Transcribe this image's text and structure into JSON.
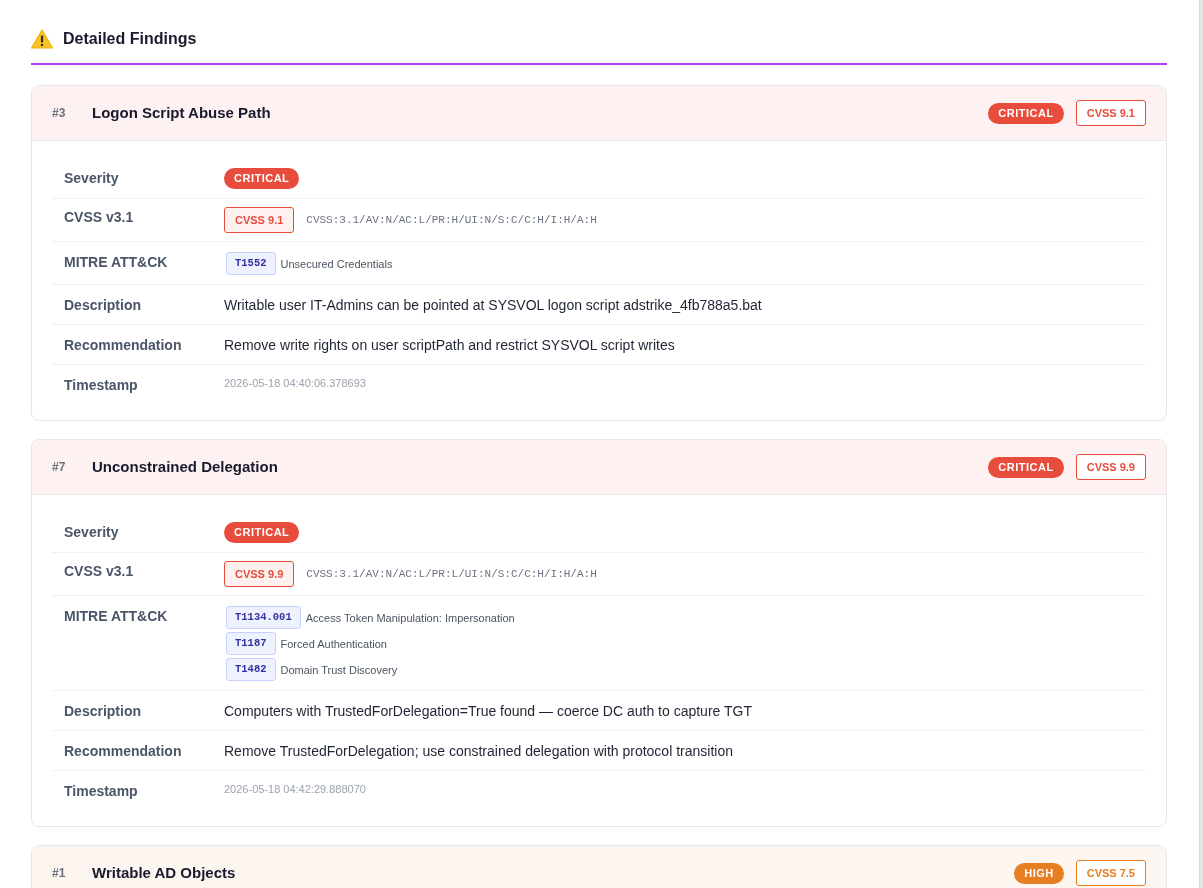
{
  "section": {
    "title": "Detailed Findings"
  },
  "findings": [
    {
      "number": "#3",
      "title": "Logon Script Abuse Path",
      "color": "#e74c3c",
      "severity_badge": "CRITICAL",
      "cvss_badge": "CVSS 9.1",
      "rows": [
        {
          "kind": "severity",
          "label": "Severity",
          "badge": "CRITICAL"
        },
        {
          "kind": "cvss",
          "label": "CVSS v3.1",
          "badge": "CVSS 9.1",
          "vector": "CVSS:3.1/AV:N/AC:L/PR:H/UI:N/S:C/C:H/I:H/A:H"
        },
        {
          "kind": "mitre",
          "label": "MITRE ATT&CK",
          "techniques": [
            {
              "id": "T1552",
              "name": "Unsecured Credentials"
            }
          ]
        },
        {
          "kind": "text",
          "label": "Description",
          "value": "Writable user IT-Admins can be pointed at SYSVOL logon script adstrike_4fb788a5.bat"
        },
        {
          "kind": "text",
          "label": "Recommendation",
          "value": "Remove write rights on user scriptPath and restrict SYSVOL script writes"
        },
        {
          "kind": "timestamp",
          "label": "Timestamp",
          "value": "2026-05-18 04:40:06.378693"
        }
      ]
    },
    {
      "number": "#7",
      "title": "Unconstrained Delegation",
      "color": "#e74c3c",
      "severity_badge": "CRITICAL",
      "cvss_badge": "CVSS 9.9",
      "rows": [
        {
          "kind": "severity",
          "label": "Severity",
          "badge": "CRITICAL"
        },
        {
          "kind": "cvss",
          "label": "CVSS v3.1",
          "badge": "CVSS 9.9",
          "vector": "CVSS:3.1/AV:N/AC:L/PR:L/UI:N/S:C/C:H/I:H/A:H"
        },
        {
          "kind": "mitre",
          "label": "MITRE ATT&CK",
          "techniques": [
            {
              "id": "T1134.001",
              "name": "Access Token Manipulation: Impersonation"
            },
            {
              "id": "T1187",
              "name": "Forced Authentication"
            },
            {
              "id": "T1482",
              "name": "Domain Trust Discovery"
            }
          ]
        },
        {
          "kind": "text",
          "label": "Description",
          "value": "Computers with TrustedForDelegation=True found — coerce DC auth to capture TGT"
        },
        {
          "kind": "text",
          "label": "Recommendation",
          "value": "Remove TrustedForDelegation; use constrained delegation with protocol transition"
        },
        {
          "kind": "timestamp",
          "label": "Timestamp",
          "value": "2026-05-18 04:42:29.888070"
        }
      ]
    },
    {
      "number": "#1",
      "title": "Writable AD Objects",
      "color": "#e67e22",
      "severity_badge": "HIGH",
      "cvss_badge": "CVSS 7.5"
    }
  ]
}
